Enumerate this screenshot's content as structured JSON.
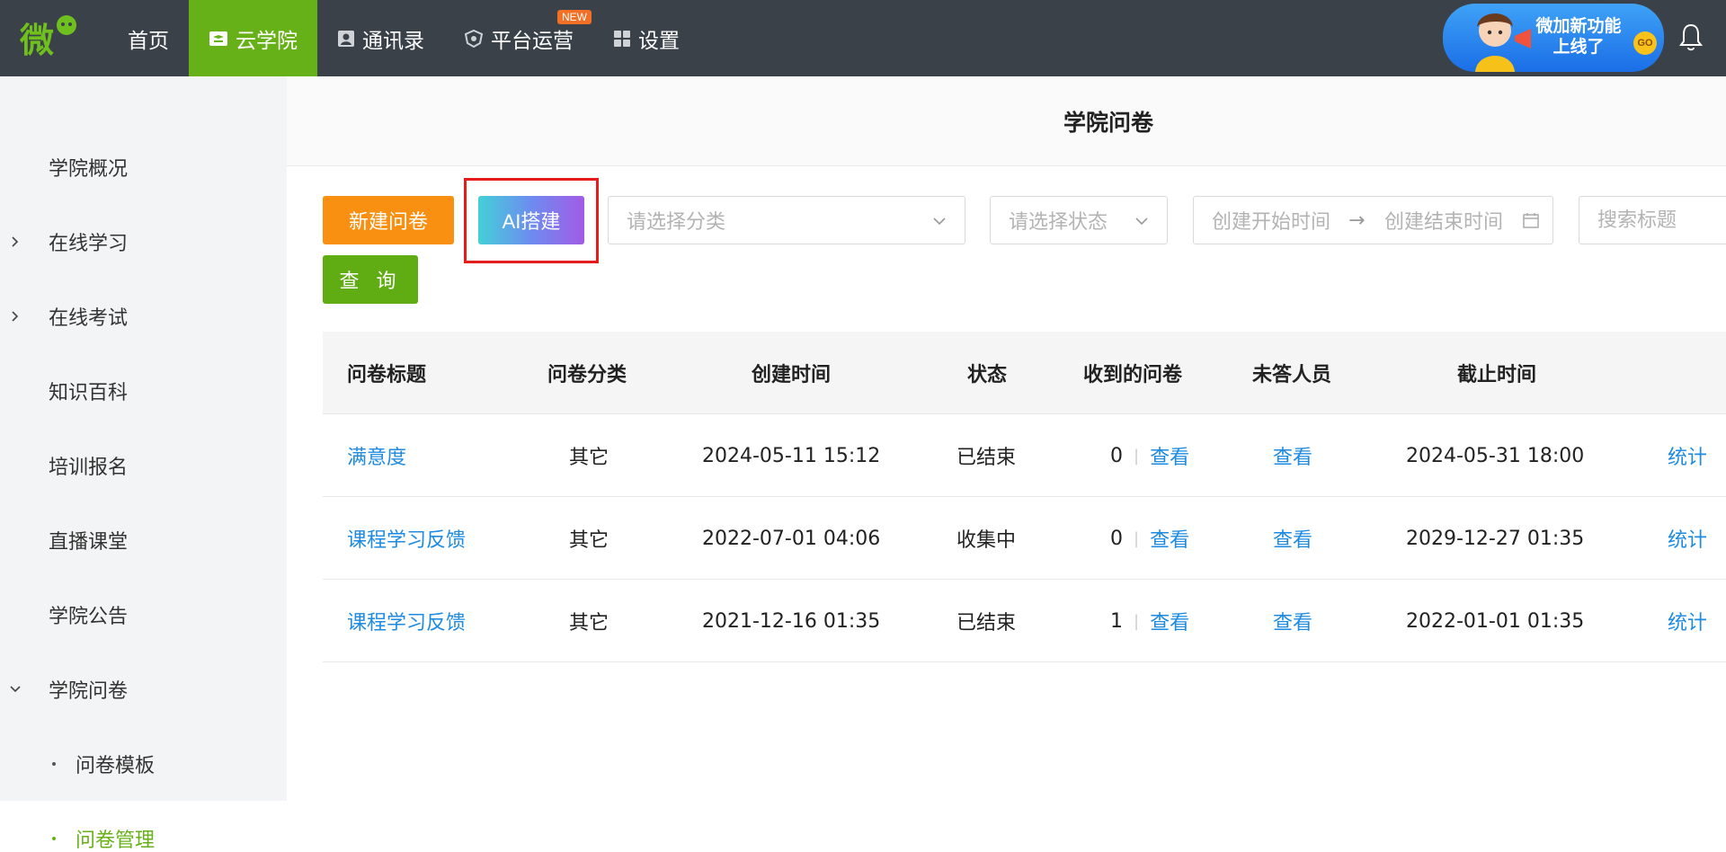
{
  "topbar": {
    "logo_text": "微",
    "nav": [
      {
        "label": "首页",
        "icon": "",
        "active": false
      },
      {
        "label": "云学院",
        "icon": "classroom-icon",
        "active": true
      },
      {
        "label": "通讯录",
        "icon": "contact-icon",
        "active": false
      },
      {
        "label": "平台运营",
        "icon": "operations-icon",
        "active": false,
        "badge": "NEW"
      },
      {
        "label": "设置",
        "icon": "grid-icon",
        "active": false
      }
    ],
    "promo": {
      "line1": "微加新功能",
      "line2": "上线了",
      "go": "GO"
    },
    "bell_icon": "bell-icon"
  },
  "sidebar": {
    "items": [
      {
        "label": "学院概况",
        "chevron": ""
      },
      {
        "label": "在线学习",
        "chevron": "right"
      },
      {
        "label": "在线考试",
        "chevron": "right"
      },
      {
        "label": "知识百科",
        "chevron": ""
      },
      {
        "label": "培训报名",
        "chevron": ""
      },
      {
        "label": "直播课堂",
        "chevron": ""
      },
      {
        "label": "学院公告",
        "chevron": ""
      },
      {
        "label": "学院问卷",
        "chevron": "down"
      }
    ],
    "subitems": [
      {
        "label": "问卷模板",
        "selected": false
      },
      {
        "label": "问卷管理",
        "selected": true
      }
    ]
  },
  "main": {
    "title": "学院问卷",
    "toolbar": {
      "new_label": "新建问卷",
      "ai_label": "AI搭建",
      "query_label": "查 询",
      "category_placeholder": "请选择分类",
      "status_placeholder": "请选择状态",
      "date_start_placeholder": "创建开始时间",
      "date_arrow": "→",
      "date_end_placeholder": "创建结束时间",
      "search_placeholder": "搜索标题"
    },
    "table": {
      "columns": [
        "问卷标题",
        "问卷分类",
        "创建时间",
        "状态",
        "收到的问卷",
        "未答人员",
        "截止时间"
      ],
      "rows": [
        {
          "title": "满意度",
          "category": "其它",
          "created": "2024-05-11 15:12",
          "status": "已结束",
          "received": "0",
          "received_link": "查看",
          "unanswered": "查看",
          "deadline": "2024-05-31 18:00",
          "action": "统计"
        },
        {
          "title": "课程学习反馈",
          "category": "其它",
          "created": "2022-07-01 04:06",
          "status": "收集中",
          "received": "0",
          "received_link": "查看",
          "unanswered": "查看",
          "deadline": "2029-12-27 01:35",
          "action": "统计"
        },
        {
          "title": "课程学习反馈",
          "category": "其它",
          "created": "2021-12-16 01:35",
          "status": "已结束",
          "received": "1",
          "received_link": "查看",
          "unanswered": "查看",
          "deadline": "2022-01-01 01:35",
          "action": "统计"
        }
      ]
    }
  },
  "colors": {
    "topbar": "#3a4149",
    "accent_green": "#67b118",
    "orange": "#f99011",
    "link_blue": "#1e8be0",
    "highlight_red": "#e61b1b"
  }
}
